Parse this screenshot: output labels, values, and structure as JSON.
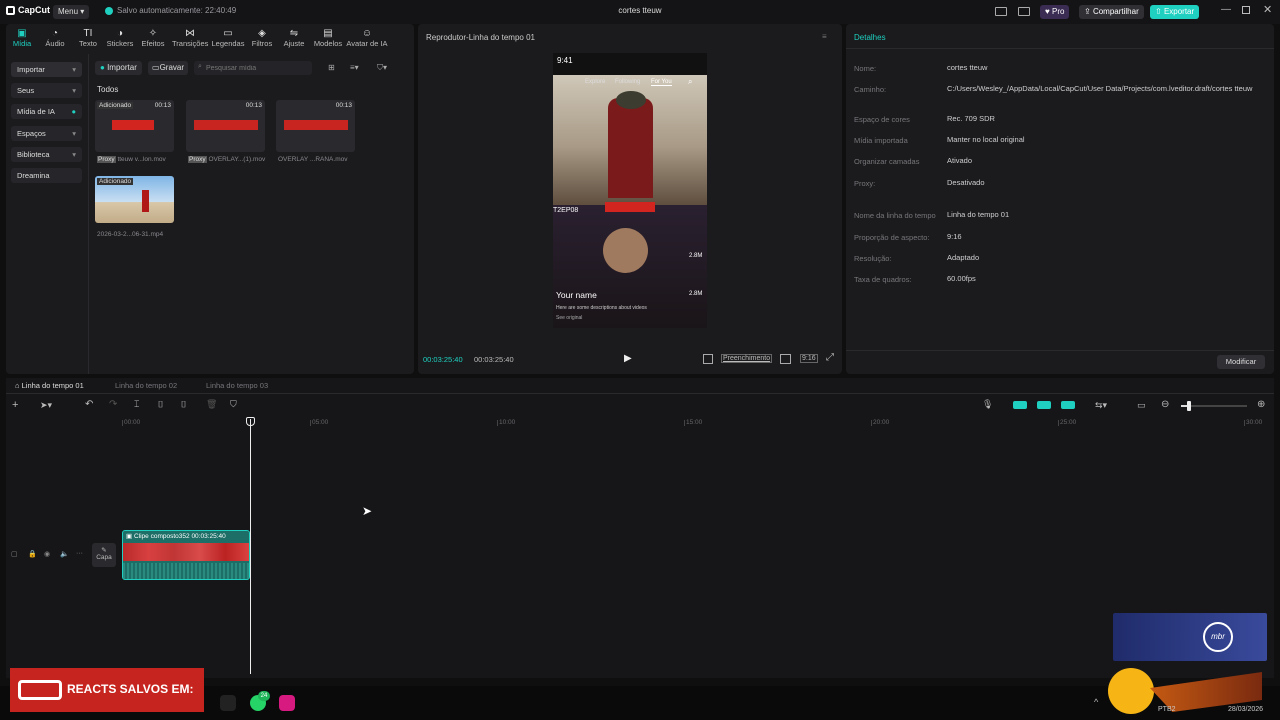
{
  "app": {
    "logo": "CapCut",
    "menu": "Menu",
    "saved_status": "Salvo automaticamente: 22:40:49",
    "window_title": "cortes tteuw",
    "pro": "Pro",
    "share": "Compartilhar",
    "export": "Exportar"
  },
  "toolbar": {
    "items": [
      "Mídia",
      "Áudio",
      "Texto",
      "Stickers",
      "Efeitos",
      "Transições",
      "Legendas",
      "Filtros",
      "Ajuste",
      "Modelos",
      "Avatar de IA"
    ]
  },
  "sidebar": {
    "items": [
      "Importar",
      "Seus",
      "Mídia de IA",
      "Espaços",
      "Biblioteca",
      "Dreamina"
    ]
  },
  "media": {
    "import_btn": "Importar",
    "record_btn": "Gravar",
    "search_placeholder": "Pesquisar mídia",
    "section": "Todos",
    "cards": [
      {
        "tag": "Adicionado",
        "duration": "00:13",
        "proxy": "Proxy",
        "name": "tteuw v...lon.mov"
      },
      {
        "tag": "",
        "duration": "00:13",
        "proxy": "Proxy",
        "name": "OVERLAY...(1).mov"
      },
      {
        "tag": "",
        "duration": "00:13",
        "proxy": "",
        "name": "OVERLAY ...RANA.mov"
      },
      {
        "tag": "Adicionado",
        "duration": "",
        "proxy": "",
        "name": "2026-03-2...06-31.mp4"
      }
    ],
    "overlay_text": "REACTS SALVOS EM:"
  },
  "player": {
    "title": "Reprodutor-Linha do tempo 01",
    "current_time": "00:03:25:40",
    "total_time": "00:03:25:40",
    "fill_label": "Preenchimento",
    "ratio_label": "9:16",
    "phone": {
      "time": "9:41",
      "tabs": [
        "Explore",
        "Following",
        "For You"
      ],
      "episode": "T2EP08",
      "username": "Your name",
      "description": "Here are some descriptions about videos",
      "see_original": "See original",
      "likes": "2.8M",
      "shares": "2.8M"
    }
  },
  "details": {
    "title": "Detalhes",
    "rows": [
      {
        "k": "Nome:",
        "v": "cortes tteuw"
      },
      {
        "k": "Caminho:",
        "v": "C:/Users/Wesley_/AppData/Local/CapCut/User Data/Projects/com.lveditor.draft/cortes tteuw"
      },
      {
        "k": "Espaço de cores",
        "v": "Rec. 709 SDR"
      },
      {
        "k": "Mídia importada",
        "v": "Manter no local original"
      },
      {
        "k": "Organizar camadas",
        "v": "Ativado"
      },
      {
        "k": "Proxy:",
        "v": "Desativado"
      },
      {
        "k": "Nome da linha do tempo",
        "v": "Linha do tempo 01"
      },
      {
        "k": "Proporção de aspecto:",
        "v": "9:16"
      },
      {
        "k": "Resolução:",
        "v": "Adaptado"
      },
      {
        "k": "Taxa de quadros:",
        "v": "60.00fps"
      }
    ],
    "modify_btn": "Modificar"
  },
  "timeline": {
    "tabs": [
      "Linha do tempo 01",
      "Linha do tempo 02",
      "Linha do tempo 03"
    ],
    "ticks": [
      "00:00",
      "05:00",
      "10:00",
      "15:00",
      "20:00",
      "25:00",
      "30:00"
    ],
    "clip_name": "Clipe composto352",
    "clip_duration": "00:03:25:40",
    "cover_label": "Capa"
  },
  "taskbar": {
    "whatsapp_badge": "24",
    "lang": "PTB2",
    "date": "28/03/2026",
    "stream_logo": "mbr"
  },
  "colors": {
    "accent": "#1fd0c0",
    "red": "#d2251f",
    "export": "#1fd0c0"
  }
}
